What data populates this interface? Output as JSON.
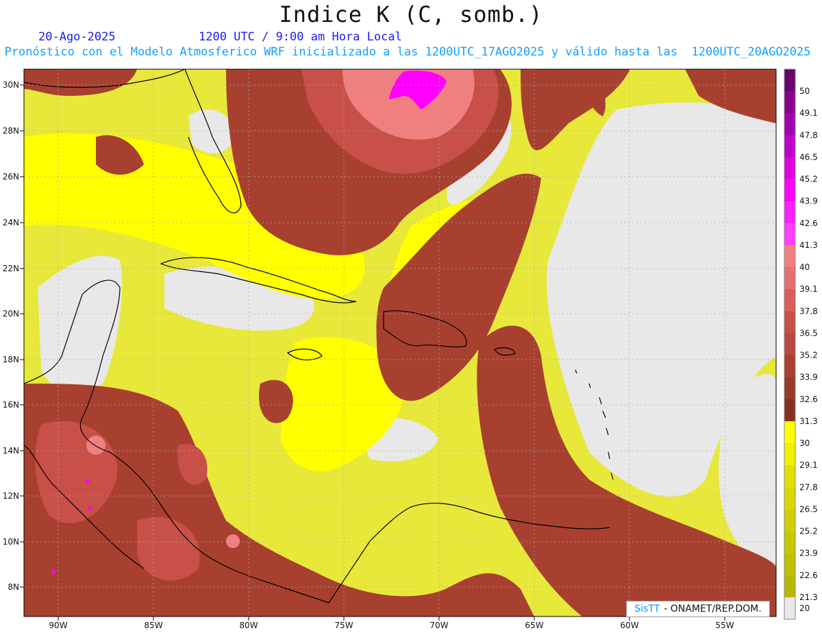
{
  "title": "Indice K (C, somb.)",
  "date": "20-Ago-2025",
  "time": "1200 UTC / 9:00 am Hora Local",
  "subtitle": "Pronóstico con el Modelo Atmosferico WRF inicializado a las 1200UTC_17AGO2025 y válido hasta las  1200UTC_20AGO2025",
  "credit": {
    "brand": "SisTT",
    "org": "- ONAMET/REP.DOM."
  },
  "lat_labels": [
    "30N",
    "28N",
    "26N",
    "24N",
    "22N",
    "20N",
    "18N",
    "16N",
    "14N",
    "12N",
    "10N",
    "8N"
  ],
  "lon_labels": [
    "90W",
    "85W",
    "80W",
    "75W",
    "70W",
    "65W",
    "60W",
    "55W"
  ],
  "colorbar": {
    "labels": [
      "50",
      "49.1",
      "47.8",
      "46.5",
      "45.2",
      "43.9",
      "42.6",
      "41.3",
      "40",
      "39.1",
      "37.8",
      "36.5",
      "35.2",
      "33.9",
      "32.6",
      "31.3",
      "30",
      "29.1",
      "27.8",
      "26.5",
      "25.2",
      "23.9",
      "22.6",
      "21.3",
      "20"
    ],
    "colors": [
      "#6a0070",
      "#8a0090",
      "#a000b0",
      "#c000c8",
      "#e000e0",
      "#ff00ff",
      "#ff20ff",
      "#ff40ff",
      "#f08080",
      "#e87070",
      "#d86058",
      "#c85048",
      "#b84840",
      "#a84030",
      "#983a28",
      "#883020",
      "#ffff00",
      "#f0f000",
      "#e0e000",
      "#d8d800",
      "#d0d000",
      "#c8c800",
      "#c0c000",
      "#b8b800",
      "#e8e8e8"
    ]
  },
  "colors": {
    "ocean_low": "#e8e8e8",
    "yellow": "#ffff00",
    "brown": "#a84030",
    "brown_light": "#c85048",
    "pink": "#f08080",
    "magenta": "#ff00ff",
    "coast": "#000000",
    "grid": "#aaaaaa"
  }
}
